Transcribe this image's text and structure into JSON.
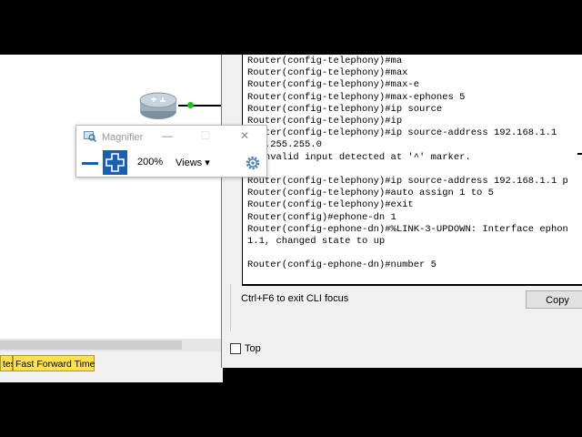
{
  "magnifier": {
    "title": "Magnifier",
    "minimize_glyph": "—",
    "maximize_glyph": "☐",
    "close_glyph": "✕",
    "zoom_level": "200%",
    "views_label": "Views",
    "views_caret": "▾",
    "icons": [
      "magnifier-app-icon",
      "zoom-out-icon",
      "zoom-in-icon",
      "gear-icon"
    ]
  },
  "workspace": {
    "device_label": "",
    "buttons": [
      {
        "label": "tes"
      },
      {
        "label": "Fast Forward Time"
      }
    ]
  },
  "cli": {
    "lines": [
      "Router(config-telephony)#ma",
      "Router(config-telephony)#max",
      "Router(config-telephony)#max-e",
      "Router(config-telephony)#max-ephones 5",
      "Router(config-telephony)#ip source",
      "Router(config-telephony)#ip",
      "Router(config-telephony)#ip source-address 192.168.1.1",
      "255.255.255.0",
      "% Invalid input detected at '^' marker.",
      "",
      "Router(config-telephony)#ip source-address 192.168.1.1 p",
      "Router(config-telephony)#auto assign 1 to 5",
      "Router(config-telephony)#exit",
      "Router(config)#ephone-dn 1",
      "Router(config-ephone-dn)#%LINK-3-UPDOWN: Interface ephon",
      "1.1, changed state to up",
      "",
      "Router(config-ephone-dn)#number 5"
    ],
    "hint": "Ctrl+F6 to exit CLI focus",
    "copy_label": "Copy",
    "top_label": "Top",
    "top_checked": false
  },
  "colors": {
    "link_green": "#16c41a",
    "button_yellow": "#ffe14d",
    "magnifier_blue": "#1a5fb4"
  }
}
